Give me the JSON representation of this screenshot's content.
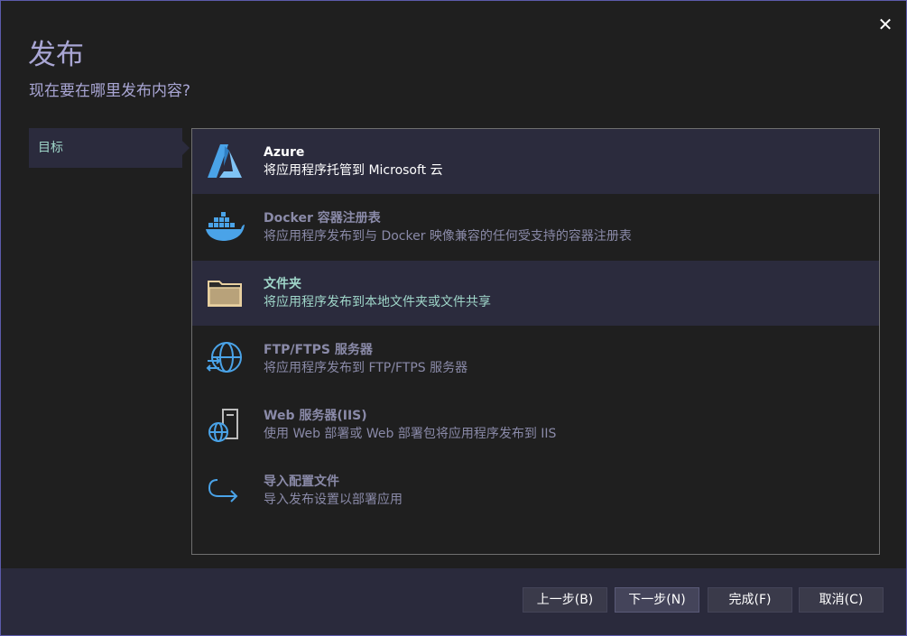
{
  "dialog": {
    "close_label": "✕",
    "title": "发布",
    "subtitle": "现在要在哪里发布内容?"
  },
  "sidebar": {
    "items": [
      {
        "label": "目标"
      }
    ]
  },
  "targets": [
    {
      "name": "Azure",
      "description": "将应用程序托管到 Microsoft 云",
      "icon": "azure-icon"
    },
    {
      "name": "Docker 容器注册表",
      "description": "将应用程序发布到与 Docker 映像兼容的任何受支持的容器注册表",
      "icon": "docker-icon"
    },
    {
      "name": "文件夹",
      "description": "将应用程序发布到本地文件夹或文件共享",
      "icon": "folder-icon"
    },
    {
      "name": "FTP/FTPS 服务器",
      "description": "将应用程序发布到 FTP/FTPS 服务器",
      "icon": "globe-transfer-icon"
    },
    {
      "name": "Web 服务器(IIS)",
      "description": "使用 Web 部署或 Web 部署包将应用程序发布到 IIS",
      "icon": "web-server-icon"
    },
    {
      "name": "导入配置文件",
      "description": "导入发布设置以部署应用",
      "icon": "import-arrow-icon"
    }
  ],
  "footer": {
    "back_label": "上一步(B)",
    "next_label": "下一步(N)",
    "finish_label": "完成(F)",
    "cancel_label": "取消(C)"
  },
  "colors": {
    "accent_border": "#5c5bab",
    "title_text": "#a9a6d4",
    "selected_text": "#9fd6c9",
    "azure_blue": "#4aa3e8",
    "folder_tan": "#e8d0a0"
  }
}
